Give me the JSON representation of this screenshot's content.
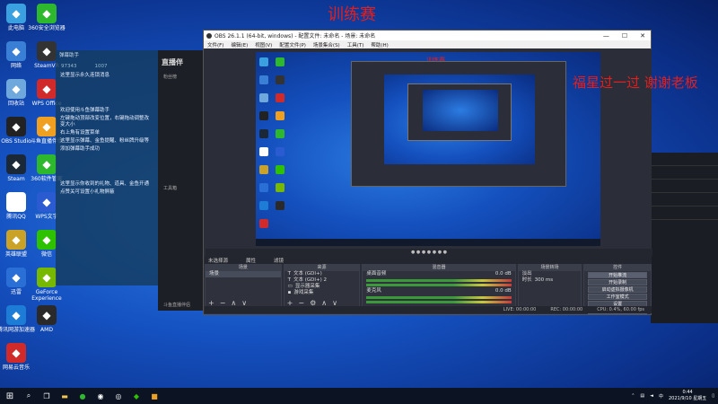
{
  "overlay": {
    "title": "训练赛"
  },
  "desktop_icons": [
    {
      "label": "此电脑",
      "icon": "computer-icon",
      "color": "#3aa0e0"
    },
    {
      "label": "360安全浏览器",
      "icon": "browser-360-icon",
      "color": "#2eb82e"
    },
    {
      "label": "网络",
      "icon": "network-icon",
      "color": "#3a7fd6"
    },
    {
      "label": "SteamVR",
      "icon": "steamvr-icon",
      "color": "#333"
    },
    {
      "label": "回收站",
      "icon": "recycle-bin-icon",
      "color": "#6fa8dc"
    },
    {
      "label": "WPS Office",
      "icon": "wps-icon",
      "color": "#d12a2a"
    },
    {
      "label": "OBS Studio",
      "icon": "obs-icon",
      "color": "#222"
    },
    {
      "label": "斗鱼直播伴侣",
      "icon": "douyu-icon",
      "color": "#f0a020"
    },
    {
      "label": "Steam",
      "icon": "steam-icon",
      "color": "#1b2838"
    },
    {
      "label": "360软件管家",
      "icon": "software-manager-icon",
      "color": "#2eb82e"
    },
    {
      "label": "腾讯QQ",
      "icon": "qq-icon",
      "color": "#ffffff"
    },
    {
      "label": "WPS文字",
      "icon": "wps-writer-icon",
      "color": "#2a5bd1"
    },
    {
      "label": "英雄联盟",
      "icon": "lol-icon",
      "color": "#c9a227"
    },
    {
      "label": "微信",
      "icon": "wechat-icon",
      "color": "#2dc100"
    },
    {
      "label": "迅雷",
      "icon": "thunder-icon",
      "color": "#2a6fd6"
    },
    {
      "label": "GeForce Experience",
      "icon": "geforce-icon",
      "color": "#76b900"
    },
    {
      "label": "腾讯网游加速器",
      "icon": "accelerator-icon",
      "color": "#1c7cd6"
    },
    {
      "label": "AMD",
      "icon": "amd-icon",
      "color": "#2a2a2a"
    },
    {
      "label": "网易云音乐",
      "icon": "netease-music-icon",
      "color": "#d12a2a"
    }
  ],
  "chat": {
    "header": "弹幕助手",
    "stat1": "97343",
    "stat2": "1007",
    "line1": "这里显示永久连锁消息",
    "line2": "欢迎使用斗鱼弹幕助手",
    "line3": "左键拖动顶部改变位置，右键拖动调整改变大小",
    "line4": "右上角有设置菜单",
    "line5": "这里显示弹幕、金鱼提醒、粉丝牌升级等",
    "line6": "添加弹幕助手成功",
    "line7": "这里显示你收到的礼物、道具、金鱼开通",
    "line8": "点赞关可设置小礼物屏蔽"
  },
  "dark_panel": {
    "logo": "直播伴",
    "item1": "粉丝榜",
    "item2": "工具箱",
    "footer": "斗鱼直播伴侣"
  },
  "obs": {
    "title": "OBS 26.1.1 (64-bit, windows) - 配置文件: 未命名 - 场景: 未命名",
    "controls": [
      "—",
      "☐",
      "✕"
    ],
    "menu": [
      "文件(F)",
      "编辑(E)",
      "视图(V)",
      "配置文件(P)",
      "场景集合(S)",
      "工具(T)",
      "帮助(H)"
    ],
    "preview_caption": "训练赛",
    "thanks": "福星过一过 谢谢老板",
    "scene_info": "未选择源",
    "props": "属性",
    "filters": "滤镜",
    "docks": {
      "scenes": {
        "header": "场景",
        "items": [
          "场景"
        ]
      },
      "sources": {
        "header": "来源",
        "items": [
          "文本 (GDI+)",
          "文本 (GDI+) 2",
          "显示器采集",
          "游戏采集"
        ]
      },
      "mixer": {
        "header": "混音器",
        "tracks": [
          {
            "name": "桌面音频",
            "db": "0.0 dB"
          },
          {
            "name": "麦克风",
            "db": "0.0 dB"
          }
        ]
      },
      "transitions": {
        "header": "场景转场",
        "type": "淡出",
        "duration_label": "时长",
        "duration": "300 ms"
      },
      "controls": {
        "header": "控件",
        "buttons": [
          "开始推流",
          "开始录制",
          "启动虚拟摄像机",
          "工作室模式",
          "设置",
          "退出"
        ]
      }
    },
    "status": {
      "live": "LIVE: 00:00:00",
      "rec": "REC: 00:00:00",
      "cpu": "CPU: 0.4%, 60.00 fps"
    }
  },
  "taskbar": {
    "time": "0:44",
    "date": "2021/9/10 星期五",
    "lang": "中"
  }
}
